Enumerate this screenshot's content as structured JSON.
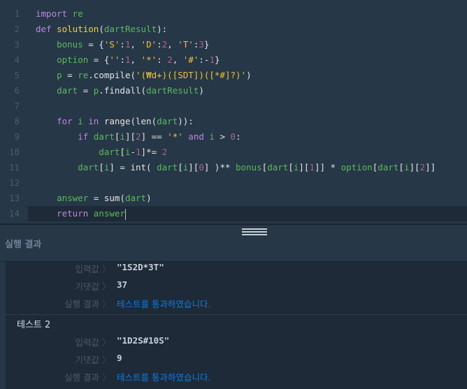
{
  "editor": {
    "active_line": 14,
    "lines": [
      [
        [
          "import",
          "kw"
        ],
        [
          " re",
          "gr"
        ]
      ],
      [
        [
          "def",
          "kw"
        ],
        [
          " solution",
          "fn"
        ],
        [
          "(",
          "df"
        ],
        [
          "dartResult",
          "gr"
        ],
        [
          "):",
          "df"
        ]
      ],
      [
        [
          "    bonus",
          "gr"
        ],
        [
          " = {",
          "df"
        ],
        [
          "'S'",
          "yl"
        ],
        [
          ":",
          "df"
        ],
        [
          "1",
          "num"
        ],
        [
          ", ",
          "df"
        ],
        [
          "'D'",
          "yl"
        ],
        [
          ":",
          "df"
        ],
        [
          "2",
          "num"
        ],
        [
          ", ",
          "df"
        ],
        [
          "'T'",
          "yl"
        ],
        [
          ":",
          "df"
        ],
        [
          "3",
          "num"
        ],
        [
          "}",
          "df"
        ]
      ],
      [
        [
          "    option",
          "gr"
        ],
        [
          " = {",
          "df"
        ],
        [
          "''",
          "yl"
        ],
        [
          ":",
          "df"
        ],
        [
          "1",
          "num"
        ],
        [
          ", ",
          "df"
        ],
        [
          "'*'",
          "yl"
        ],
        [
          ": ",
          "df"
        ],
        [
          "2",
          "num"
        ],
        [
          ", ",
          "df"
        ],
        [
          "'#'",
          "yl"
        ],
        [
          ":-",
          "df"
        ],
        [
          "1",
          "num"
        ],
        [
          "}",
          "df"
        ]
      ],
      [
        [
          "    p",
          "gr"
        ],
        [
          " = ",
          "df"
        ],
        [
          "re",
          "gr"
        ],
        [
          ".compile(",
          "df"
        ],
        [
          "'(₩d+)([SDT])([*#]?)'",
          "yl"
        ],
        [
          ")",
          "df"
        ]
      ],
      [
        [
          "    dart",
          "gr"
        ],
        [
          " = ",
          "df"
        ],
        [
          "p",
          "gr"
        ],
        [
          ".findall(",
          "df"
        ],
        [
          "dartResult",
          "gr"
        ],
        [
          ")",
          "df"
        ]
      ],
      [],
      [
        [
          "    for",
          "kw"
        ],
        [
          " i",
          "gr"
        ],
        [
          " in",
          "kw"
        ],
        [
          " range(len(",
          "df"
        ],
        [
          "dart",
          "gr"
        ],
        [
          ")):",
          "df"
        ]
      ],
      [
        [
          "        if",
          "kw"
        ],
        [
          " dart",
          "gr"
        ],
        [
          "[",
          "df"
        ],
        [
          "i",
          "gr"
        ],
        [
          "][",
          "df"
        ],
        [
          "2",
          "num"
        ],
        [
          "] == ",
          "df"
        ],
        [
          "'*'",
          "yl"
        ],
        [
          " and",
          "kw"
        ],
        [
          " i",
          "gr"
        ],
        [
          " > ",
          "df"
        ],
        [
          "0",
          "num"
        ],
        [
          ":",
          "df"
        ]
      ],
      [
        [
          "            dart",
          "gr"
        ],
        [
          "[",
          "df"
        ],
        [
          "i",
          "gr"
        ],
        [
          "-",
          "df"
        ],
        [
          "1",
          "num"
        ],
        [
          "]*= ",
          "df"
        ],
        [
          "2",
          "num"
        ]
      ],
      [
        [
          "        dart",
          "gr"
        ],
        [
          "[",
          "df"
        ],
        [
          "i",
          "gr"
        ],
        [
          "] = int( ",
          "df"
        ],
        [
          "dart",
          "gr"
        ],
        [
          "[",
          "df"
        ],
        [
          "i",
          "gr"
        ],
        [
          "][",
          "df"
        ],
        [
          "0",
          "num"
        ],
        [
          "] )** ",
          "df"
        ],
        [
          "bonus",
          "gr"
        ],
        [
          "[",
          "df"
        ],
        [
          "dart",
          "gr"
        ],
        [
          "[",
          "df"
        ],
        [
          "i",
          "gr"
        ],
        [
          "][",
          "df"
        ],
        [
          "1",
          "num"
        ],
        [
          "]] * ",
          "df"
        ],
        [
          "option",
          "gr"
        ],
        [
          "[",
          "df"
        ],
        [
          "dart",
          "gr"
        ],
        [
          "[",
          "df"
        ],
        [
          "i",
          "gr"
        ],
        [
          "][",
          "df"
        ],
        [
          "2",
          "num"
        ],
        [
          "]]",
          "df"
        ]
      ],
      [],
      [
        [
          "    answer",
          "gr"
        ],
        [
          " = sum(",
          "df"
        ],
        [
          "dart",
          "gr"
        ],
        [
          ")",
          "df"
        ]
      ],
      [
        [
          "    return",
          "kw"
        ],
        [
          " answer",
          "gr"
        ]
      ]
    ]
  },
  "results": {
    "title": "실행 결과",
    "arrow": "〉",
    "labels": {
      "input": "입력값",
      "expected": "기댓값",
      "result": "실행 결과"
    },
    "tests": [
      {
        "name": "",
        "input": "\"1S2D*3T\"",
        "expected": "37",
        "result": "테스트를 통과하였습니다."
      },
      {
        "name": "테스트 2",
        "input": "\"1D2S#10S\"",
        "expected": "9",
        "result": "테스트를 통과하였습니다."
      }
    ]
  },
  "colors": {
    "pass": "#0d7ae6",
    "background": "#263747"
  }
}
